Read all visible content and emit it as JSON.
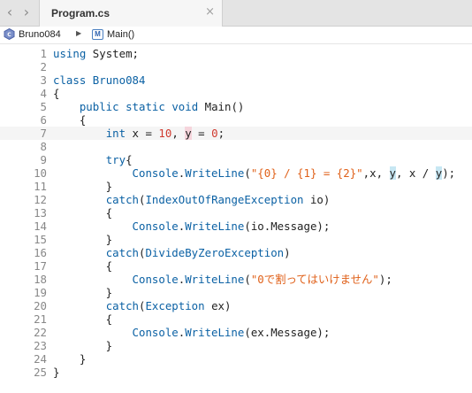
{
  "tabbar": {
    "back_glyph": "‹",
    "forward_glyph": "›",
    "tab_title": "Program.cs",
    "close_glyph": "×"
  },
  "breadcrumb": {
    "class_name": "Bruno084",
    "separator": "▶",
    "method_icon_letter": "M",
    "method_name": "Main()"
  },
  "editor": {
    "current_line": 7,
    "lines": [
      {
        "n": "1",
        "tokens": [
          {
            "t": "using",
            "c": "kw"
          },
          {
            "t": " System;",
            "c": ""
          }
        ]
      },
      {
        "n": "2",
        "tokens": []
      },
      {
        "n": "3",
        "tokens": [
          {
            "t": "class",
            "c": "kw"
          },
          {
            "t": " ",
            "c": ""
          },
          {
            "t": "Bruno084",
            "c": "ty"
          }
        ]
      },
      {
        "n": "4",
        "tokens": [
          {
            "t": "{",
            "c": ""
          }
        ]
      },
      {
        "n": "5",
        "tokens": [
          {
            "t": "    ",
            "c": ""
          },
          {
            "t": "public",
            "c": "kw"
          },
          {
            "t": " ",
            "c": ""
          },
          {
            "t": "static",
            "c": "kw"
          },
          {
            "t": " ",
            "c": ""
          },
          {
            "t": "void",
            "c": "kw"
          },
          {
            "t": " Main()",
            "c": ""
          }
        ]
      },
      {
        "n": "6",
        "tokens": [
          {
            "t": "    {",
            "c": ""
          }
        ]
      },
      {
        "n": "7",
        "tokens": [
          {
            "t": "        ",
            "c": ""
          },
          {
            "t": "int",
            "c": "kw"
          },
          {
            "t": " x = ",
            "c": ""
          },
          {
            "t": "10",
            "c": "num"
          },
          {
            "t": ", ",
            "c": ""
          },
          {
            "t": "y",
            "c": "hl-red"
          },
          {
            "t": " = ",
            "c": ""
          },
          {
            "t": "0",
            "c": "num"
          },
          {
            "t": ";",
            "c": ""
          }
        ]
      },
      {
        "n": "8",
        "tokens": []
      },
      {
        "n": "9",
        "tokens": [
          {
            "t": "        ",
            "c": ""
          },
          {
            "t": "try",
            "c": "kw"
          },
          {
            "t": "{",
            "c": ""
          }
        ]
      },
      {
        "n": "10",
        "tokens": [
          {
            "t": "            ",
            "c": ""
          },
          {
            "t": "Console",
            "c": "ty"
          },
          {
            "t": ".",
            "c": ""
          },
          {
            "t": "WriteLine",
            "c": "ty"
          },
          {
            "t": "(",
            "c": ""
          },
          {
            "t": "\"{0} / {1} = {2}\"",
            "c": "str"
          },
          {
            "t": ",x, ",
            "c": ""
          },
          {
            "t": "y",
            "c": "hl-blue"
          },
          {
            "t": ", x / ",
            "c": ""
          },
          {
            "t": "y",
            "c": "hl-blue"
          },
          {
            "t": ");",
            "c": ""
          }
        ]
      },
      {
        "n": "11",
        "tokens": [
          {
            "t": "        }",
            "c": ""
          }
        ]
      },
      {
        "n": "12",
        "tokens": [
          {
            "t": "        ",
            "c": ""
          },
          {
            "t": "catch",
            "c": "kw"
          },
          {
            "t": "(",
            "c": ""
          },
          {
            "t": "IndexOutOfRangeException",
            "c": "ty"
          },
          {
            "t": " io)",
            "c": ""
          }
        ]
      },
      {
        "n": "13",
        "tokens": [
          {
            "t": "        {",
            "c": ""
          }
        ]
      },
      {
        "n": "14",
        "tokens": [
          {
            "t": "            ",
            "c": ""
          },
          {
            "t": "Console",
            "c": "ty"
          },
          {
            "t": ".",
            "c": ""
          },
          {
            "t": "WriteLine",
            "c": "ty"
          },
          {
            "t": "(io.Message);",
            "c": ""
          }
        ]
      },
      {
        "n": "15",
        "tokens": [
          {
            "t": "        }",
            "c": ""
          }
        ]
      },
      {
        "n": "16",
        "tokens": [
          {
            "t": "        ",
            "c": ""
          },
          {
            "t": "catch",
            "c": "kw"
          },
          {
            "t": "(",
            "c": ""
          },
          {
            "t": "DivideByZeroException",
            "c": "ty"
          },
          {
            "t": ")",
            "c": ""
          }
        ]
      },
      {
        "n": "17",
        "tokens": [
          {
            "t": "        {",
            "c": ""
          }
        ]
      },
      {
        "n": "18",
        "tokens": [
          {
            "t": "            ",
            "c": ""
          },
          {
            "t": "Console",
            "c": "ty"
          },
          {
            "t": ".",
            "c": ""
          },
          {
            "t": "WriteLine",
            "c": "ty"
          },
          {
            "t": "(",
            "c": ""
          },
          {
            "t": "\"0で割ってはいけません\"",
            "c": "str"
          },
          {
            "t": ");",
            "c": ""
          }
        ]
      },
      {
        "n": "19",
        "tokens": [
          {
            "t": "        }",
            "c": ""
          }
        ]
      },
      {
        "n": "20",
        "tokens": [
          {
            "t": "        ",
            "c": ""
          },
          {
            "t": "catch",
            "c": "kw"
          },
          {
            "t": "(",
            "c": ""
          },
          {
            "t": "Exception",
            "c": "ty"
          },
          {
            "t": " ex)",
            "c": ""
          }
        ]
      },
      {
        "n": "21",
        "tokens": [
          {
            "t": "        {",
            "c": ""
          }
        ]
      },
      {
        "n": "22",
        "tokens": [
          {
            "t": "            ",
            "c": ""
          },
          {
            "t": "Console",
            "c": "ty"
          },
          {
            "t": ".",
            "c": ""
          },
          {
            "t": "WriteLine",
            "c": "ty"
          },
          {
            "t": "(ex.Message);",
            "c": ""
          }
        ]
      },
      {
        "n": "23",
        "tokens": [
          {
            "t": "        }",
            "c": ""
          }
        ]
      },
      {
        "n": "24",
        "tokens": [
          {
            "t": "    }",
            "c": ""
          }
        ]
      },
      {
        "n": "25",
        "tokens": [
          {
            "t": "}",
            "c": ""
          }
        ]
      }
    ]
  },
  "colors": {
    "keyword": "#0b61a4",
    "number": "#d03a2f",
    "string": "#e0611a",
    "highlight_selected_symbol": "#f6d5dc",
    "highlight_symbol_occurrence": "#c7e7f3"
  }
}
